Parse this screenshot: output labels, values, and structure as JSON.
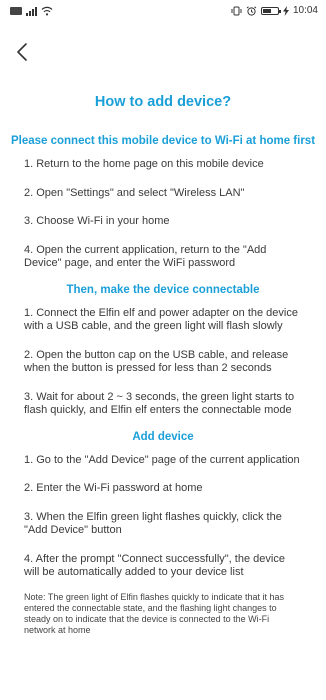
{
  "status_bar": {
    "time": "10:04",
    "battery_level": 0.6
  },
  "header": {
    "title": "How to add device?"
  },
  "sections": [
    {
      "heading": "Please connect this mobile device to Wi-Fi at home first",
      "steps": [
        "1. Return to the home page on this mobile device",
        "2. Open \"Settings\" and select \"Wireless LAN\"",
        "3. Choose Wi-Fi in your home",
        "4. Open the current application, return to the \"Add Device\" page, and enter the WiFi password"
      ]
    },
    {
      "heading": "Then, make the device connectable",
      "steps": [
        "1. Connect the Elfin elf and power adapter on the device with a USB cable, and the green light will flash slowly",
        "2. Open the button cap on the USB cable, and release when the button is pressed for less than 2 seconds",
        "3. Wait for about 2 ~ 3 seconds, the green light starts to flash quickly, and Elfin elf enters the connectable mode"
      ]
    },
    {
      "heading": "Add device",
      "steps": [
        "1. Go to the \"Add Device\" page of the current application",
        "2. Enter the Wi-Fi password at home",
        "3. When the Elfin green light flashes quickly, click the \"Add Device\" button",
        "4. After the prompt \"Connect successfully\", the device will be automatically added to your device list"
      ]
    }
  ],
  "note": "Note: The green light of Elfin flashes quickly to indicate that it has entered the connectable state, and the flashing light changes to steady on to indicate that the device is connected to the Wi-Fi network at home"
}
